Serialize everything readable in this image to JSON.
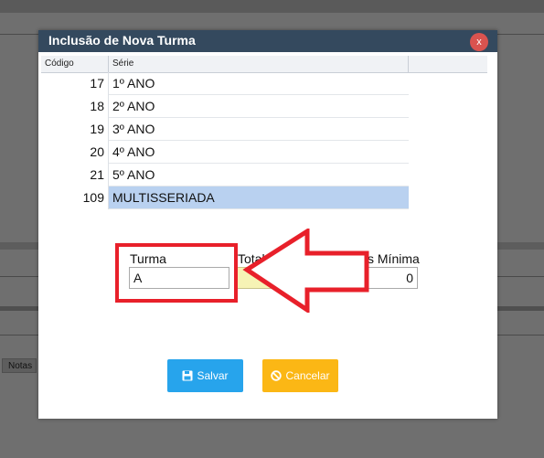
{
  "background": {
    "tab_label": "Notas"
  },
  "modal": {
    "title": "Inclusão de Nova Turma",
    "close_label": "x",
    "grid": {
      "columns": [
        "Código",
        "Série"
      ],
      "rows": [
        {
          "code": "17",
          "serie": "1º ANO"
        },
        {
          "code": "18",
          "serie": "2º ANO"
        },
        {
          "code": "19",
          "serie": "3º ANO"
        },
        {
          "code": "20",
          "serie": "4º ANO"
        },
        {
          "code": "21",
          "serie": "5º ANO"
        },
        {
          "code": "109",
          "serie": "MULTISSERIADA",
          "selected": true
        }
      ]
    },
    "form": {
      "turma_label": "Turma",
      "turma_value": "A",
      "total_label_partial": "Total",
      "minima_label_partial": "s Mínima",
      "minima_value": "0"
    },
    "buttons": {
      "save_label": "Salvar",
      "cancel_label": "Cancelar"
    }
  },
  "colors": {
    "header": "#34495e",
    "close": "#d9534f",
    "selected_row": "#b9d1f0",
    "save": "#27a4ec",
    "cancel": "#fbb715",
    "annotation": "#e8202a"
  },
  "icons": {
    "save": "floppy-disk-icon",
    "cancel": "ban-icon"
  }
}
